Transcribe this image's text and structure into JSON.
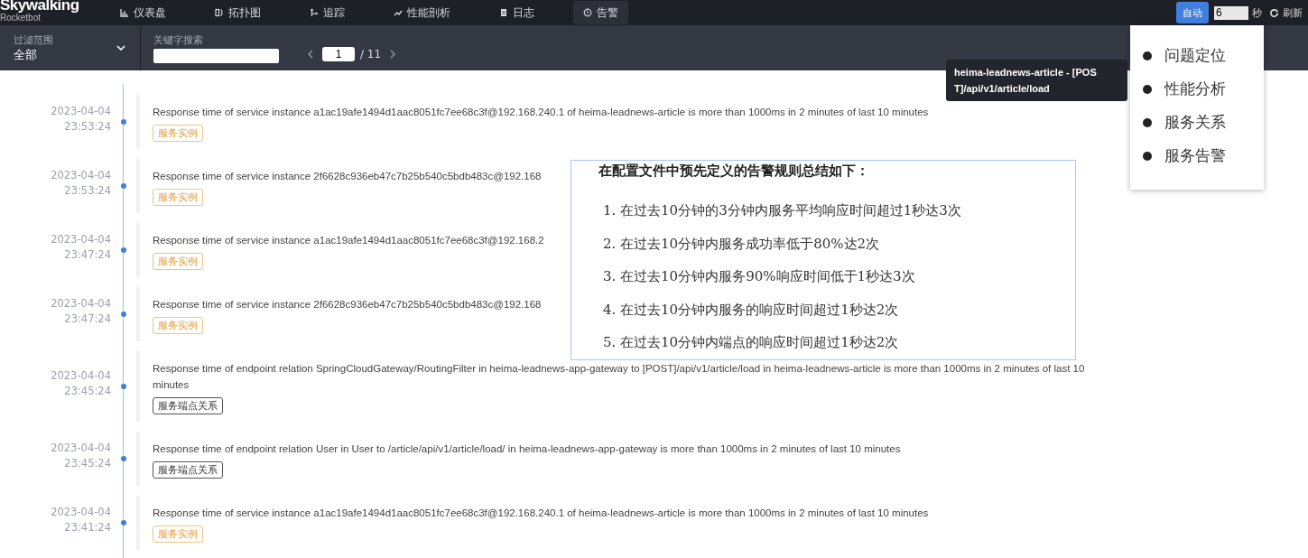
{
  "brand": {
    "name": "Skywalking",
    "subtitle": "Rocketbot"
  },
  "nav": [
    {
      "label": "仪表盘",
      "kind": "chart",
      "selected": false
    },
    {
      "label": "拓扑图",
      "kind": "topo",
      "selected": false
    },
    {
      "label": "追踪",
      "kind": "trace",
      "selected": false
    },
    {
      "label": "性能剖析",
      "kind": "line",
      "selected": false
    },
    {
      "label": "日志",
      "kind": "doc",
      "selected": false
    },
    {
      "label": "告警",
      "kind": "alert",
      "selected": true
    }
  ],
  "auto_refresh": {
    "button": "自动",
    "interval": "6",
    "unit": "秒",
    "refresh": "刷新"
  },
  "filter": {
    "label": "过滤范围",
    "value": "全部"
  },
  "search": {
    "label": "关键字搜索"
  },
  "pager": {
    "page": "1",
    "total": "/ 11"
  },
  "alerts": [
    {
      "date": "2023-04-04",
      "time": "23:53:24",
      "message": "Response time of service instance a1ac19afe1494d1aac8051fc7ee68c3f@192.168.240.1 of heima-leadnews-article is more than 1000ms in 2 minutes of last 10 minutes",
      "tag": "服务实例",
      "kind": "instance"
    },
    {
      "date": "2023-04-04",
      "time": "23:53:24",
      "message": "Response time of service instance 2f6628c936eb47c7b25b540c5bdb483c@192.168",
      "tag": "服务实例",
      "kind": "instance"
    },
    {
      "date": "2023-04-04",
      "time": "23:47:24",
      "message": "Response time of service instance a1ac19afe1494d1aac8051fc7ee68c3f@192.168.2",
      "tag": "服务实例",
      "kind": "instance"
    },
    {
      "date": "2023-04-04",
      "time": "23:47:24",
      "message": "Response time of service instance 2f6628c936eb47c7b25b540c5bdb483c@192.168",
      "tag": "服务实例",
      "kind": "instance"
    },
    {
      "date": "2023-04-04",
      "time": "23:45:24",
      "message": "Response time of endpoint relation SpringCloudGateway/RoutingFilter in heima-leadnews-app-gateway to [POST]/api/v1/article/load in heima-leadnews-article is more than 1000ms in 2 minutes of last 10 minutes",
      "tag": "服务端点关系",
      "kind": "endpoint"
    },
    {
      "date": "2023-04-04",
      "time": "23:45:24",
      "message": "Response time of endpoint relation User in User to /article/api/v1/article/load/ in heima-leadnews-app-gateway is more than 1000ms in 2 minutes of last 10 minutes",
      "tag": "服务端点关系",
      "kind": "endpoint"
    },
    {
      "date": "2023-04-04",
      "time": "23:41:24",
      "message": "Response time of service instance a1ac19afe1494d1aac8051fc7ee68c3f@192.168.240.1 of heima-leadnews-article is more than 1000ms in 2 minutes of last 10 minutes",
      "tag": "服务实例",
      "kind": "instance"
    }
  ],
  "tooltip": {
    "lines": [
      "heima-leadnews-article - [POS",
      "T]/api/v1/article/load"
    ]
  },
  "rules_panel": {
    "title": "在配置文件中预先定义的告警规则总结如下：",
    "items": [
      "1. 在过去10分钟的3分钟内服务平均响应时间超过1秒达3次",
      "2. 在过去10分钟内服务成功率低于80%达2次",
      "3. 在过去10分钟内服务90%响应时间低于1秒达3次",
      "4. 在过去10分钟内服务的响应时间超过1秒达2次",
      "5. 在过去10分钟内端点的响应时间超过1秒达2次"
    ]
  },
  "side_menu": {
    "items": [
      "问题定位",
      "性能分析",
      "服务关系",
      "服务告警"
    ]
  }
}
